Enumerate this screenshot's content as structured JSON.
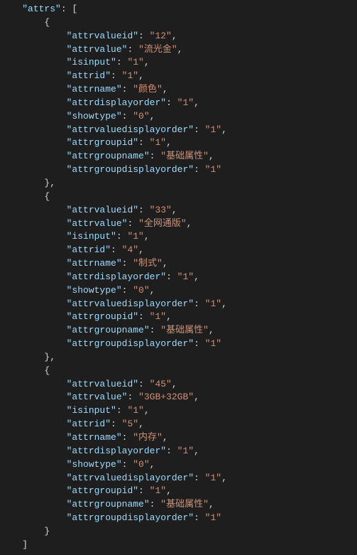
{
  "rootKey": "attrs",
  "items": [
    {
      "attrvalueid": "12",
      "attrvalue": "流光金",
      "isinput": "1",
      "attrid": "1",
      "attrname": "颜色",
      "attrdisplayorder": "1",
      "showtype": "0",
      "attrvaluedisplayorder": "1",
      "attrgroupid": "1",
      "attrgroupname": "基础属性",
      "attrgroupdisplayorder": "1"
    },
    {
      "attrvalueid": "33",
      "attrvalue": "全网通版",
      "isinput": "1",
      "attrid": "4",
      "attrname": "制式",
      "attrdisplayorder": "1",
      "showtype": "0",
      "attrvaluedisplayorder": "1",
      "attrgroupid": "1",
      "attrgroupname": "基础属性",
      "attrgroupdisplayorder": "1"
    },
    {
      "attrvalueid": "45",
      "attrvalue": "3GB+32GB",
      "isinput": "1",
      "attrid": "5",
      "attrname": "内存",
      "attrdisplayorder": "1",
      "showtype": "0",
      "attrvaluedisplayorder": "1",
      "attrgroupid": "1",
      "attrgroupname": "基础属性",
      "attrgroupdisplayorder": "1"
    }
  ],
  "keyOrder": [
    "attrvalueid",
    "attrvalue",
    "isinput",
    "attrid",
    "attrname",
    "attrdisplayorder",
    "showtype",
    "attrvaluedisplayorder",
    "attrgroupid",
    "attrgroupname",
    "attrgroupdisplayorder"
  ]
}
